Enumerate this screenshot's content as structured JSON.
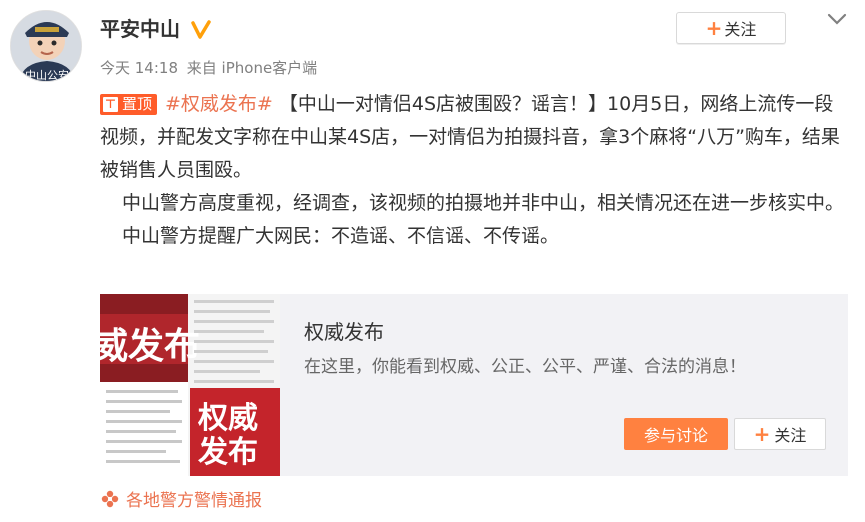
{
  "author": {
    "name": "平安中山",
    "avatar_text": "中山公安",
    "verified_icon": "verified-icon"
  },
  "follow_button": {
    "plus": "+",
    "label": "关注"
  },
  "meta": {
    "time": "今天 14:18",
    "source": "来自 iPhone客户端"
  },
  "post": {
    "badge": "置顶",
    "topic": "#权威发布#",
    "para1": "【中山一对情侣4S店被围殴？谣言！】10月5日，网络上流传一段视频，并配发文字称在中山某4S店，一对情侣为拍摄抖音，拿3个麻将“八万”购车，结果被销售人员围殴。",
    "para2": "中山警方高度重视，经调查，该视频的拍摄地并非中山，相关情况还在进一步核实中。",
    "para3": "中山警方提醒广大网民：不造谣、不信谣、不传谣。"
  },
  "card": {
    "thumb_big_text": "威发布",
    "thumb_logo_line1": "权威",
    "thumb_logo_line2": "发布",
    "title": "权威发布",
    "description": "在这里，你能看到权威、公正、公平、严谨、合法的消息！",
    "discuss_label": "参与讨论",
    "follow_plus": "+",
    "follow_label": "关注"
  },
  "location": {
    "label": "各地警方警情通报"
  },
  "colors": {
    "accent": "#eb7350",
    "badge": "#ff5c2a",
    "button": "#ff8140",
    "verified": "#ffa00a"
  }
}
